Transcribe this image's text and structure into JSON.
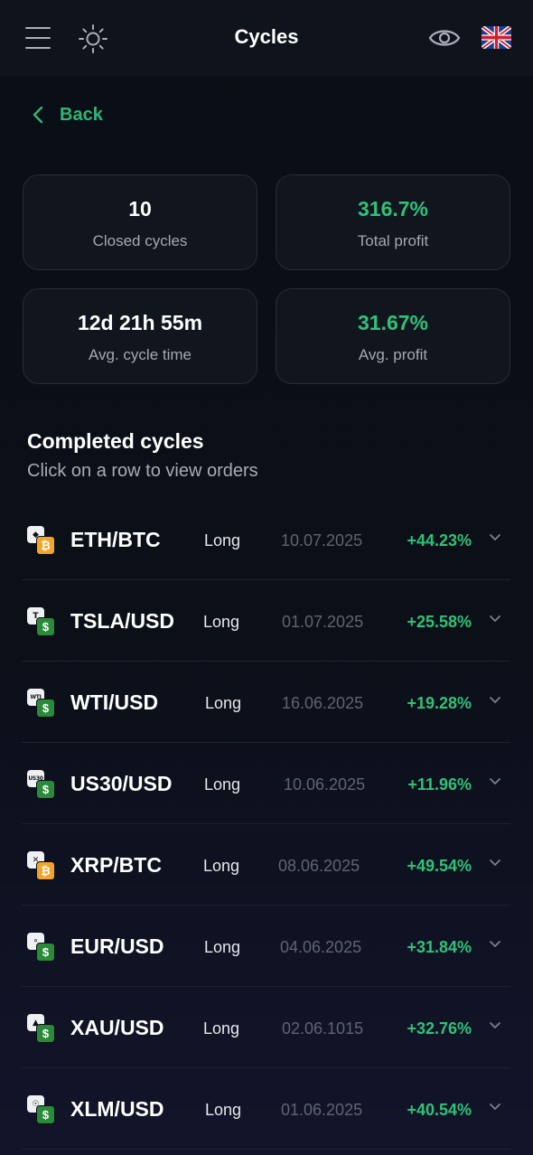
{
  "header": {
    "title": "Cycles",
    "menu_icon": "hamburger-menu-icon",
    "theme_icon": "sun-icon",
    "visibility_icon": "eye-icon",
    "language_icon": "uk-flag-icon"
  },
  "back": {
    "label": "Back"
  },
  "stats": {
    "closed_cycles": {
      "value": "10",
      "label": "Closed cycles"
    },
    "total_profit": {
      "value": "316.7%",
      "label": "Total profit"
    },
    "avg_cycle_time": {
      "value": "12d 21h 55m",
      "label": "Avg. cycle time"
    },
    "avg_profit": {
      "value": "31.67%",
      "label": "Avg. profit"
    }
  },
  "completed": {
    "title": "Completed cycles",
    "subtitle": "Click on a row to view orders"
  },
  "colors": {
    "accent_green": "#2ec278",
    "btc_orange": "#f2a42a",
    "usd_green": "#2a8a3a"
  },
  "cycles": [
    {
      "pair": "ETH/BTC",
      "direction": "Long",
      "date": "10.07.2025",
      "profit": "+44.23%",
      "base_icon": "eth-icon",
      "quote_icon": "btc-icon"
    },
    {
      "pair": "TSLA/USD",
      "direction": "Long",
      "date": "01.07.2025",
      "profit": "+25.58%",
      "base_icon": "tesla-icon",
      "quote_icon": "usd-icon"
    },
    {
      "pair": "WTI/USD",
      "direction": "Long",
      "date": "16.06.2025",
      "profit": "+19.28%",
      "base_icon": "wti-icon",
      "quote_icon": "usd-icon"
    },
    {
      "pair": "US30/USD",
      "direction": "Long",
      "date": "10.06.2025",
      "profit": "+11.96%",
      "base_icon": "us30-icon",
      "quote_icon": "usd-icon"
    },
    {
      "pair": "XRP/BTC",
      "direction": "Long",
      "date": "08.06.2025",
      "profit": "+49.54%",
      "base_icon": "xrp-icon",
      "quote_icon": "btc-icon"
    },
    {
      "pair": "EUR/USD",
      "direction": "Long",
      "date": "04.06.2025",
      "profit": "+31.84%",
      "base_icon": "eur-icon",
      "quote_icon": "usd-icon"
    },
    {
      "pair": "XAU/USD",
      "direction": "Long",
      "date": "02.06.1015",
      "profit": "+32.76%",
      "base_icon": "gold-icon",
      "quote_icon": "usd-icon"
    },
    {
      "pair": "XLM/USD",
      "direction": "Long",
      "date": "01.06.2025",
      "profit": "+40.54%",
      "base_icon": "stellar-icon",
      "quote_icon": "usd-icon"
    }
  ]
}
